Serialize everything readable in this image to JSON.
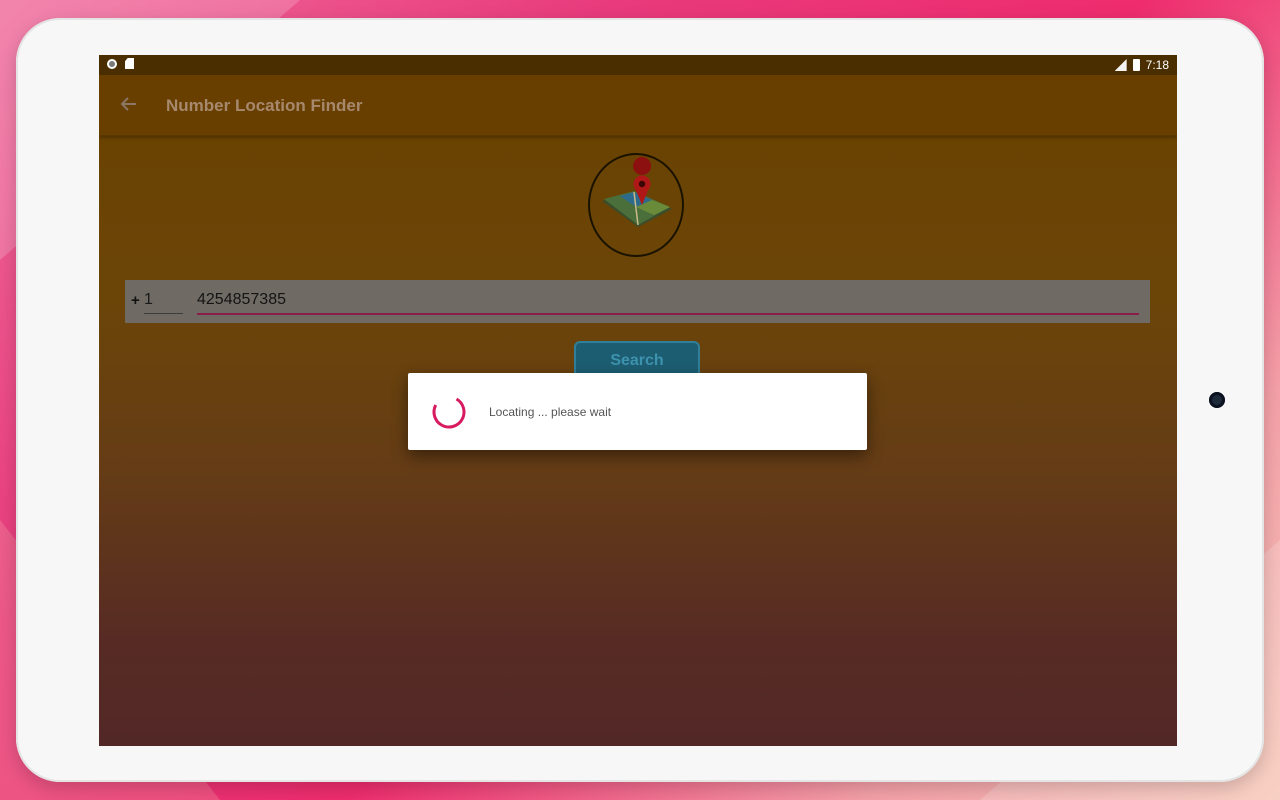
{
  "statusbar": {
    "left_icons": [
      "record-icon",
      "sd-card-icon"
    ],
    "right_icons": [
      "signal-icon",
      "battery-icon"
    ],
    "time": "7:18"
  },
  "appbar": {
    "back_icon": "back-arrow-icon",
    "title": "Number Location Finder"
  },
  "logo": {
    "icon": "map-pin-icon"
  },
  "phone_input": {
    "plus_sign": "+",
    "country_code": "1",
    "number": "4254857385"
  },
  "search_button": {
    "label": "Search"
  },
  "progress_dialog": {
    "message": "Locating ... please wait",
    "spinner_icon": "loading-spinner-icon"
  },
  "colors": {
    "accent": "#d81b60",
    "appbar": "#693f00",
    "statusbar": "#4a2e00"
  }
}
